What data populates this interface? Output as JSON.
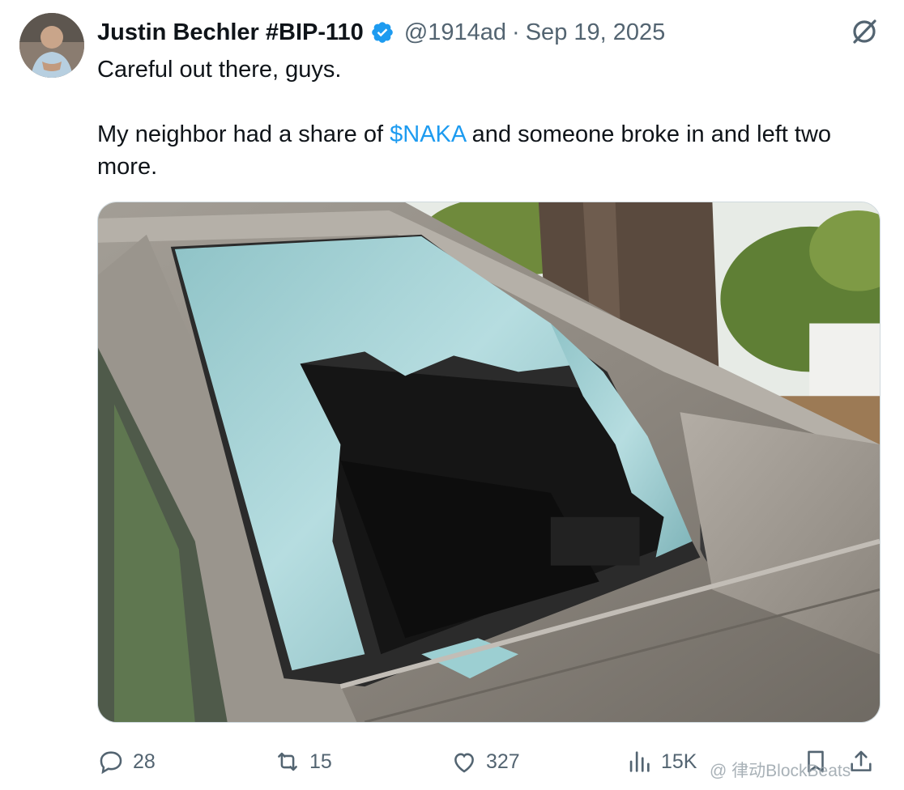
{
  "author": {
    "name": "Justin Bechler #BIP-110",
    "handle": "@1914ad",
    "separator": "·",
    "date": "Sep 19, 2025"
  },
  "tweet": {
    "line1": "Careful out there, guys.",
    "line2_before": "My neighbor had a share of ",
    "cashtag": "$NAKA",
    "line2_after": " and someone broke in and left two more."
  },
  "actions": {
    "replies": "28",
    "reposts": "15",
    "likes": "327",
    "views": "15K"
  },
  "watermark": "@ 律动BlockBeats",
  "colors": {
    "accent": "#1d9bf0",
    "text_primary": "#0f1419",
    "text_secondary": "#536471"
  },
  "icons": [
    "grok-icon",
    "verified-badge-icon",
    "reply-icon",
    "repost-icon",
    "like-icon",
    "views-icon",
    "bookmark-icon",
    "share-icon"
  ]
}
